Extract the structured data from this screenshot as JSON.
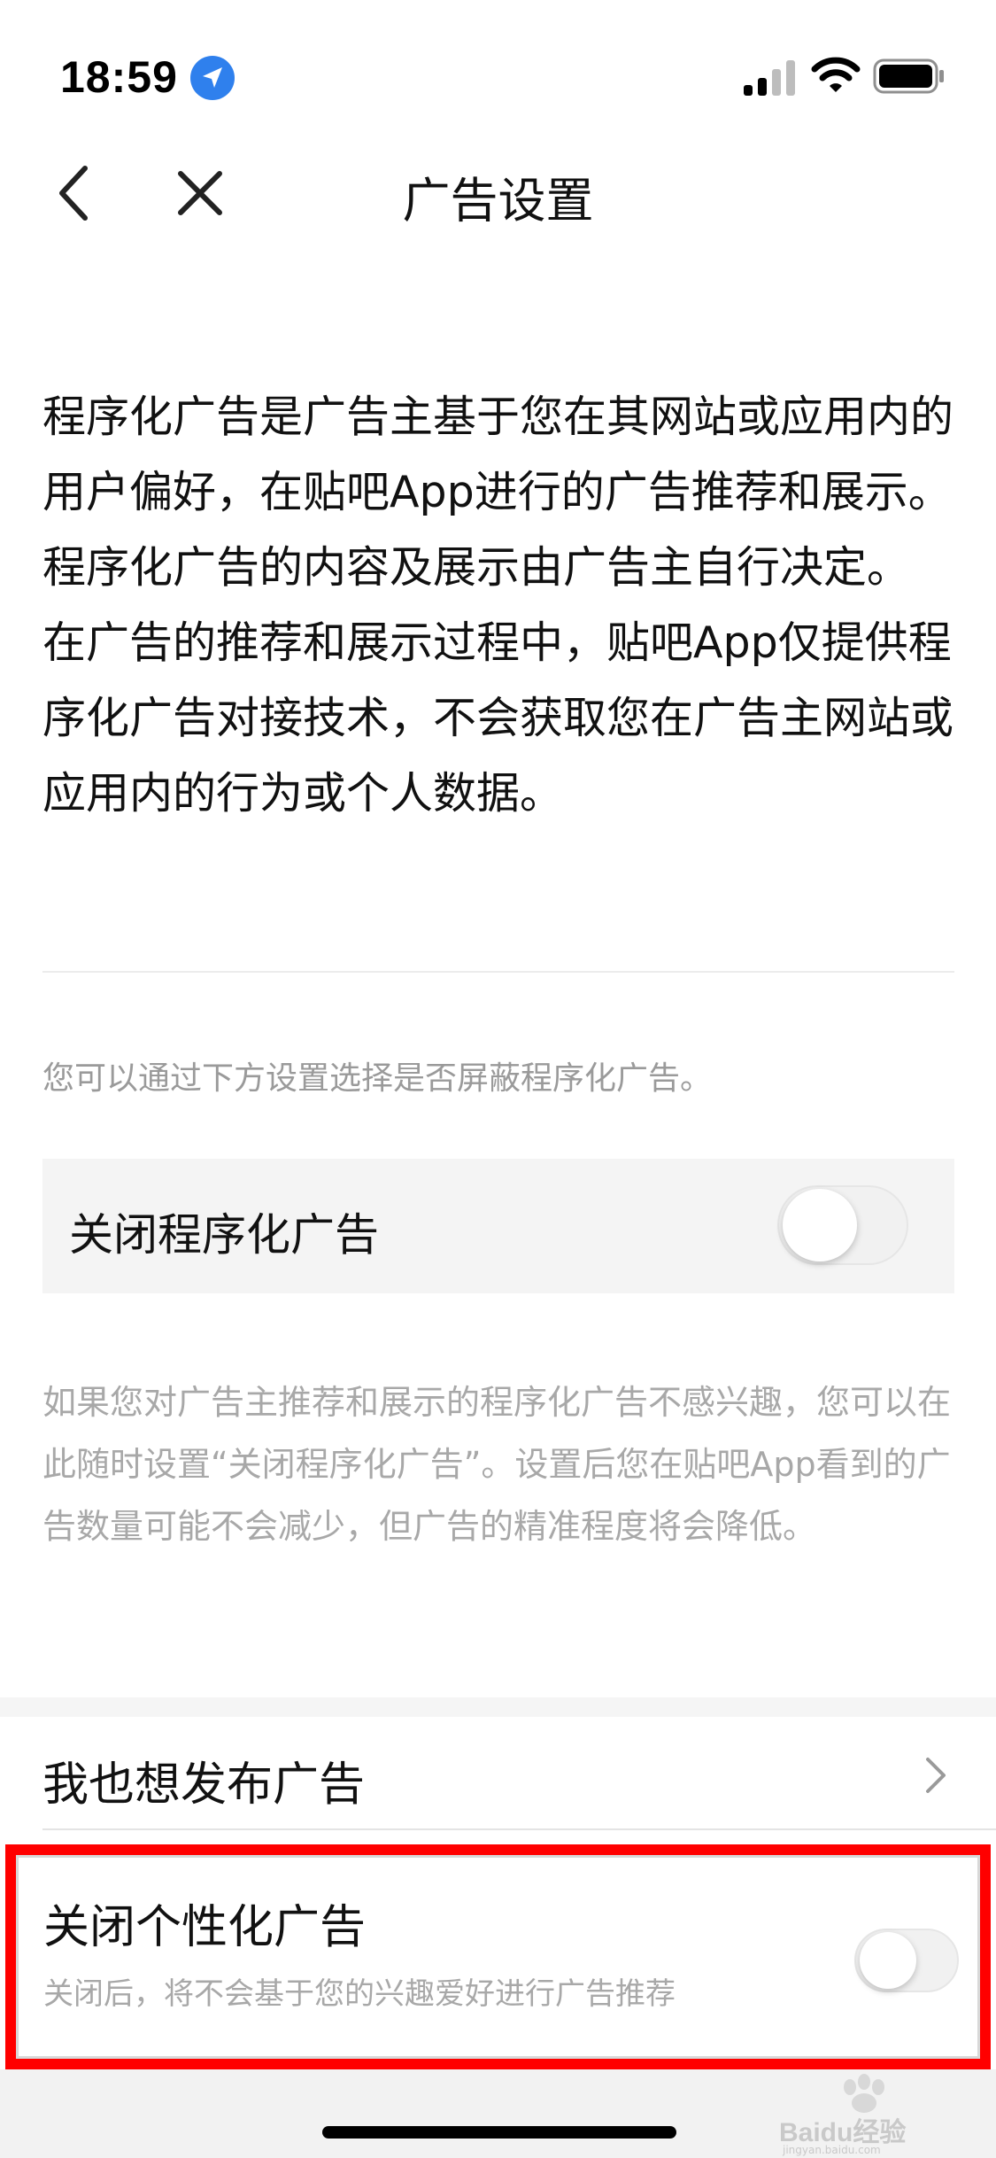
{
  "status_bar": {
    "time": "18:59"
  },
  "nav": {
    "title": "广告设置"
  },
  "intro": {
    "text": "程序化广告是广告主基于您在其网站或应用内的用户偏好，在贴吧App进行的广告推荐和展示。程序化广告的内容及展示由广告主自行决定。 在广告的推荐和展示过程中，贴吧App仅提供程序化广告对接技术，不会获取您在广告主网站或应用内的行为或个人数据。"
  },
  "hint": "您可以通过下方设置选择是否屏蔽程序化广告。",
  "programmatic_setting": {
    "label": "关闭程序化广告",
    "enabled": false
  },
  "description": "如果您对广告主推荐和展示的程序化广告不感兴趣，您可以在此随时设置“关闭程序化广告”。设置后您在贴吧App看到的广告数量可能不会减少，但广告的精准程度将会降低。",
  "publish_row": {
    "label": "我也想发布广告"
  },
  "personalized_setting": {
    "label": "关闭个性化广告",
    "subtitle": "关闭后，将不会基于您的兴趣爱好进行广告推荐",
    "enabled": false
  },
  "watermark": {
    "text": "Baidu经验",
    "sub": "jingyan.baidu.com"
  },
  "colors": {
    "highlight": "#ff0000",
    "location_badge": "#2f80ed",
    "muted_text": "#a8a8a8"
  }
}
